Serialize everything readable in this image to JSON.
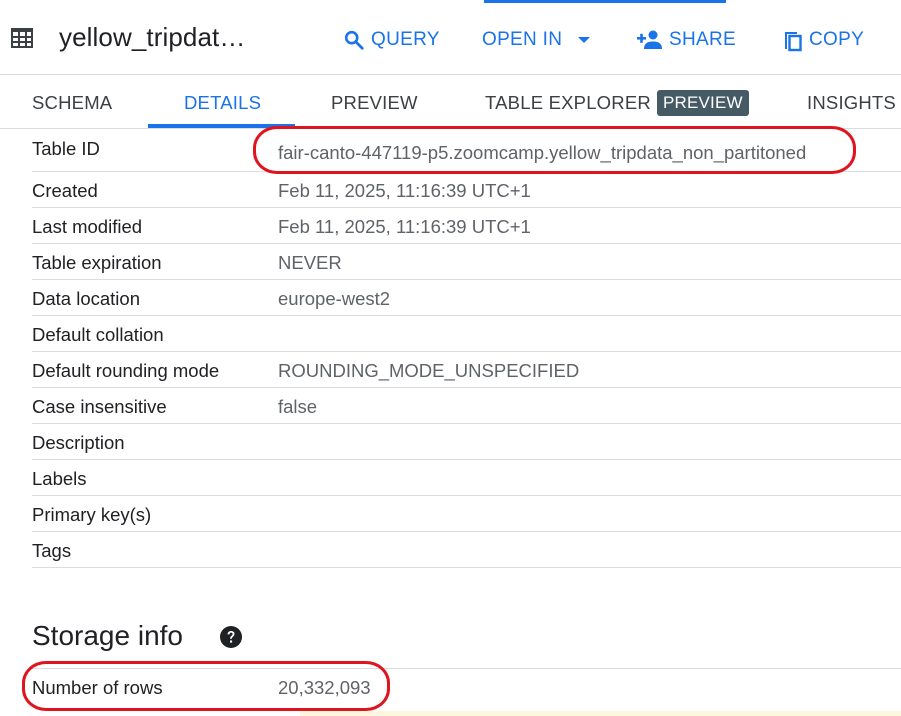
{
  "header": {
    "title": "yellow_tripdat…",
    "buttons": {
      "query": "QUERY",
      "open_in": "OPEN IN",
      "share": "SHARE",
      "copy": "COPY"
    }
  },
  "tabs": [
    {
      "label": "SCHEMA"
    },
    {
      "label": "DETAILS",
      "active": true
    },
    {
      "label": "PREVIEW"
    },
    {
      "label": "TABLE EXPLORER",
      "badge": "PREVIEW"
    },
    {
      "label": "INSIGHTS"
    }
  ],
  "details": [
    {
      "key": "Table ID",
      "value": "fair-canto-447119-p5.zoomcamp.yellow_tripdata_non_partitoned"
    },
    {
      "key": "Created",
      "value": "Feb 11, 2025, 11:16:39 UTC+1"
    },
    {
      "key": "Last modified",
      "value": "Feb 11, 2025, 11:16:39 UTC+1"
    },
    {
      "key": "Table expiration",
      "value": "NEVER"
    },
    {
      "key": "Data location",
      "value": "europe-west2"
    },
    {
      "key": "Default collation",
      "value": ""
    },
    {
      "key": "Default rounding mode",
      "value": "ROUNDING_MODE_UNSPECIFIED"
    },
    {
      "key": "Case insensitive",
      "value": "false"
    },
    {
      "key": "Description",
      "value": ""
    },
    {
      "key": "Labels",
      "value": ""
    },
    {
      "key": "Primary key(s)",
      "value": ""
    },
    {
      "key": "Tags",
      "value": ""
    }
  ],
  "storage": {
    "title": "Storage info",
    "rows_label": "Number of rows",
    "rows_value": "20,332,093"
  },
  "colors": {
    "accent": "#1a73e8",
    "annotation": "#e0141e",
    "badge_bg": "#455a64"
  }
}
